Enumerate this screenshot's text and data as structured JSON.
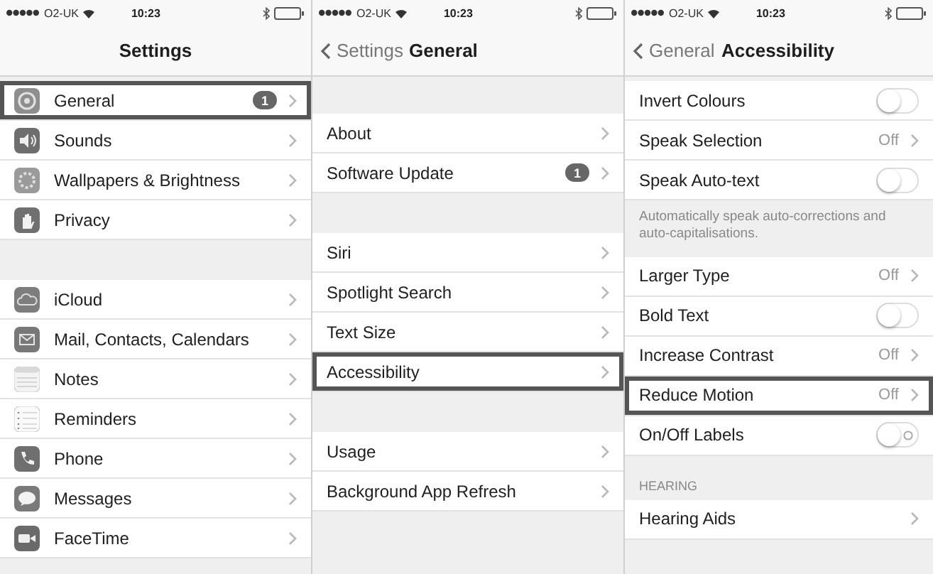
{
  "screens": [
    {
      "status_bar": {
        "carrier": "O2-UK",
        "time": "10:23"
      },
      "nav": {
        "title": "Settings"
      },
      "scrolled": true,
      "sections": [
        {
          "rows": [
            {
              "kind": "link",
              "label": "General",
              "badge": "1",
              "highlighted": true
            },
            {
              "kind": "link",
              "label": "Sounds",
              "highlighted": false
            },
            {
              "kind": "link",
              "label": "Wallpapers & Brightness",
              "highlighted": false
            },
            {
              "kind": "link",
              "label": "Privacy",
              "highlighted": false
            }
          ]
        },
        {
          "rows": [
            {
              "kind": "link",
              "label": "iCloud",
              "highlighted": false
            },
            {
              "kind": "link",
              "label": "Mail, Contacts, Calendars",
              "highlighted": false
            },
            {
              "kind": "link",
              "label": "Notes",
              "highlighted": false
            },
            {
              "kind": "link",
              "label": "Reminders",
              "highlighted": false
            },
            {
              "kind": "link",
              "label": "Phone",
              "highlighted": false
            },
            {
              "kind": "link",
              "label": "Messages",
              "highlighted": false
            },
            {
              "kind": "link",
              "label": "FaceTime",
              "highlighted": false
            }
          ]
        }
      ]
    },
    {
      "status_bar": {
        "carrier": "O2-UK",
        "time": "10:23"
      },
      "nav": {
        "back": "Settings",
        "title": "General"
      },
      "scrolled": false,
      "sections": [
        {
          "rows": [
            {
              "kind": "link",
              "label": "About",
              "highlighted": false
            },
            {
              "kind": "link",
              "label": "Software Update",
              "badge": "1",
              "highlighted": false
            }
          ]
        },
        {
          "rows": [
            {
              "kind": "link",
              "label": "Siri",
              "highlighted": false
            },
            {
              "kind": "link",
              "label": "Spotlight Search",
              "highlighted": false
            },
            {
              "kind": "link",
              "label": "Text Size",
              "highlighted": false
            },
            {
              "kind": "link",
              "label": "Accessibility",
              "highlighted": true
            }
          ]
        },
        {
          "rows": [
            {
              "kind": "link",
              "label": "Usage",
              "highlighted": false
            },
            {
              "kind": "link",
              "label": "Background App Refresh",
              "highlighted": false
            }
          ]
        }
      ]
    },
    {
      "status_bar": {
        "carrier": "O2-UK",
        "time": "10:23"
      },
      "nav": {
        "back": "General",
        "title": "Accessibility"
      },
      "scrolled": true,
      "sections": [
        {
          "footer": "Automatically speak auto-corrections and auto-capitalisations.",
          "rows": [
            {
              "kind": "toggle",
              "label": "Invert Colours",
              "on": false,
              "labels": false,
              "highlighted": false
            },
            {
              "kind": "link",
              "label": "Speak Selection",
              "value": "Off",
              "highlighted": false
            },
            {
              "kind": "toggle",
              "label": "Speak Auto-text",
              "on": false,
              "labels": false,
              "highlighted": false
            }
          ]
        },
        {
          "rows": [
            {
              "kind": "link",
              "label": "Larger Type",
              "value": "Off",
              "highlighted": false
            },
            {
              "kind": "toggle",
              "label": "Bold Text",
              "on": false,
              "labels": false,
              "highlighted": false
            },
            {
              "kind": "link",
              "label": "Increase Contrast",
              "value": "Off",
              "highlighted": false
            },
            {
              "kind": "link",
              "label": "Reduce Motion",
              "value": "Off",
              "highlighted": true
            },
            {
              "kind": "toggle",
              "label": "On/Off Labels",
              "on": false,
              "labels": true,
              "highlighted": false
            }
          ]
        },
        {
          "header": "HEARING",
          "rows": [
            {
              "kind": "link",
              "label": "Hearing Aids",
              "highlighted": false
            }
          ]
        }
      ]
    }
  ]
}
